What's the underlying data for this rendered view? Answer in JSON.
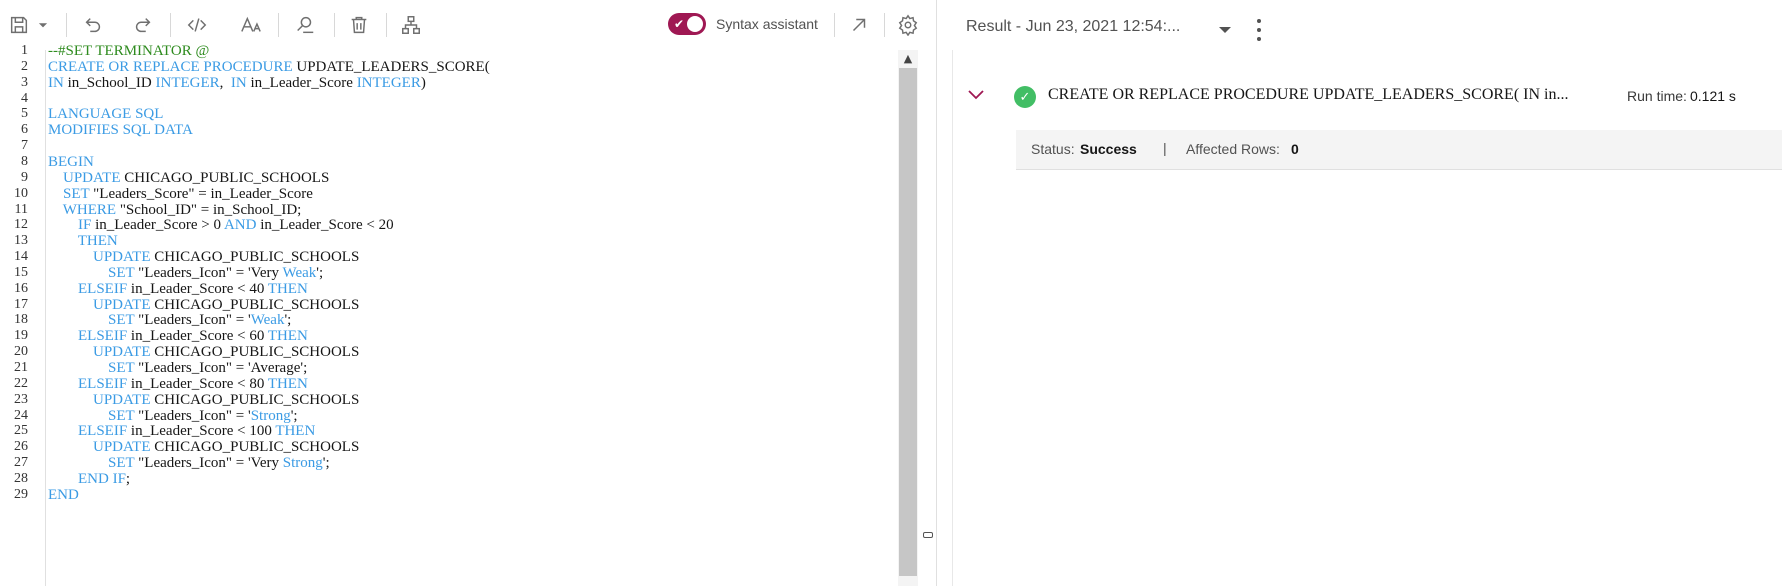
{
  "toolbar": {
    "icons": [
      "save-icon",
      "save-dropdown-icon",
      "undo-icon",
      "redo-icon",
      "code-format-icon",
      "font-size-icon",
      "find-replace-icon",
      "delete-icon",
      "explain-plan-icon",
      "expand-icon",
      "settings-icon"
    ],
    "syntax_assistant_label": "Syntax assistant",
    "syntax_assistant_on": true,
    "accent": "#9f1853"
  },
  "editor": {
    "line_numbers": [
      "1",
      "2",
      "3",
      "4",
      "5",
      "6",
      "7",
      "8",
      "9",
      "10",
      "11",
      "12",
      "13",
      "14",
      "15",
      "16",
      "17",
      "18",
      "19",
      "20",
      "21",
      "22",
      "23",
      "24",
      "25",
      "26",
      "27",
      "28",
      "29"
    ],
    "colors": {
      "keyword": "#3b9be4",
      "comment": "#2e8b1e",
      "text": "#161616"
    },
    "lines": [
      [
        {
          "t": "--#SET TERMINATOR @",
          "c": "cm"
        }
      ],
      [
        {
          "t": "CREATE OR REPLACE PROCEDURE",
          "c": "kw"
        },
        {
          "t": " UPDATE_LEADERS_SCORE(",
          "c": ""
        }
      ],
      [
        {
          "t": "IN",
          "c": "kw"
        },
        {
          "t": " in_School_ID ",
          "c": ""
        },
        {
          "t": "INTEGER",
          "c": "kw"
        },
        {
          "t": ",  ",
          "c": ""
        },
        {
          "t": "IN",
          "c": "kw"
        },
        {
          "t": " in_Leader_Score ",
          "c": ""
        },
        {
          "t": "INTEGER",
          "c": "kw"
        },
        {
          "t": ")",
          "c": ""
        }
      ],
      [],
      [
        {
          "t": "LANGUAGE SQL",
          "c": "kw"
        }
      ],
      [
        {
          "t": "MODIFIES SQL DATA",
          "c": "kw"
        }
      ],
      [],
      [
        {
          "t": "BEGIN",
          "c": "kw"
        }
      ],
      [
        {
          "t": "    ",
          "c": ""
        },
        {
          "t": "UPDATE",
          "c": "kw"
        },
        {
          "t": " CHICAGO_PUBLIC_SCHOOLS",
          "c": ""
        }
      ],
      [
        {
          "t": "    ",
          "c": ""
        },
        {
          "t": "SET",
          "c": "kw"
        },
        {
          "t": " \"Leaders_Score\" = in_Leader_Score",
          "c": ""
        }
      ],
      [
        {
          "t": "    ",
          "c": ""
        },
        {
          "t": "WHERE",
          "c": "kw"
        },
        {
          "t": " \"School_ID\" = in_School_ID;",
          "c": ""
        }
      ],
      [
        {
          "t": "        ",
          "c": ""
        },
        {
          "t": "IF",
          "c": "kw"
        },
        {
          "t": " in_Leader_Score > 0 ",
          "c": ""
        },
        {
          "t": "AND",
          "c": "kw"
        },
        {
          "t": " in_Leader_Score < 20",
          "c": ""
        }
      ],
      [
        {
          "t": "        ",
          "c": ""
        },
        {
          "t": "THEN",
          "c": "kw"
        }
      ],
      [
        {
          "t": "            ",
          "c": ""
        },
        {
          "t": "UPDATE",
          "c": "kw"
        },
        {
          "t": " CHICAGO_PUBLIC_SCHOOLS",
          "c": ""
        }
      ],
      [
        {
          "t": "                ",
          "c": ""
        },
        {
          "t": "SET",
          "c": "kw"
        },
        {
          "t": " \"Leaders_Icon\" = 'Very ",
          "c": ""
        },
        {
          "t": "Weak",
          "c": "kw"
        },
        {
          "t": "';",
          "c": ""
        }
      ],
      [
        {
          "t": "        ",
          "c": ""
        },
        {
          "t": "ELSEIF",
          "c": "kw"
        },
        {
          "t": " in_Leader_Score < 40 ",
          "c": ""
        },
        {
          "t": "THEN",
          "c": "kw"
        }
      ],
      [
        {
          "t": "            ",
          "c": ""
        },
        {
          "t": "UPDATE",
          "c": "kw"
        },
        {
          "t": " CHICAGO_PUBLIC_SCHOOLS",
          "c": ""
        }
      ],
      [
        {
          "t": "                ",
          "c": ""
        },
        {
          "t": "SET",
          "c": "kw"
        },
        {
          "t": " \"Leaders_Icon\" = '",
          "c": ""
        },
        {
          "t": "Weak",
          "c": "kw"
        },
        {
          "t": "';",
          "c": ""
        }
      ],
      [
        {
          "t": "        ",
          "c": ""
        },
        {
          "t": "ELSEIF",
          "c": "kw"
        },
        {
          "t": " in_Leader_Score < 60 ",
          "c": ""
        },
        {
          "t": "THEN",
          "c": "kw"
        }
      ],
      [
        {
          "t": "            ",
          "c": ""
        },
        {
          "t": "UPDATE",
          "c": "kw"
        },
        {
          "t": " CHICAGO_PUBLIC_SCHOOLS",
          "c": ""
        }
      ],
      [
        {
          "t": "                ",
          "c": ""
        },
        {
          "t": "SET",
          "c": "kw"
        },
        {
          "t": " \"Leaders_Icon\" = 'Average';",
          "c": ""
        }
      ],
      [
        {
          "t": "        ",
          "c": ""
        },
        {
          "t": "ELSEIF",
          "c": "kw"
        },
        {
          "t": " in_Leader_Score < 80 ",
          "c": ""
        },
        {
          "t": "THEN",
          "c": "kw"
        }
      ],
      [
        {
          "t": "            ",
          "c": ""
        },
        {
          "t": "UPDATE",
          "c": "kw"
        },
        {
          "t": " CHICAGO_PUBLIC_SCHOOLS",
          "c": ""
        }
      ],
      [
        {
          "t": "                ",
          "c": ""
        },
        {
          "t": "SET",
          "c": "kw"
        },
        {
          "t": " \"Leaders_Icon\" = '",
          "c": ""
        },
        {
          "t": "Strong",
          "c": "kw"
        },
        {
          "t": "';",
          "c": ""
        }
      ],
      [
        {
          "t": "        ",
          "c": ""
        },
        {
          "t": "ELSEIF",
          "c": "kw"
        },
        {
          "t": " in_Leader_Score < 100 ",
          "c": ""
        },
        {
          "t": "THEN",
          "c": "kw"
        }
      ],
      [
        {
          "t": "            ",
          "c": ""
        },
        {
          "t": "UPDATE",
          "c": "kw"
        },
        {
          "t": " CHICAGO_PUBLIC_SCHOOLS",
          "c": ""
        }
      ],
      [
        {
          "t": "                ",
          "c": ""
        },
        {
          "t": "SET",
          "c": "kw"
        },
        {
          "t": " \"Leaders_Icon\" = 'Very ",
          "c": ""
        },
        {
          "t": "Strong",
          "c": "kw"
        },
        {
          "t": "';",
          "c": ""
        }
      ],
      [
        {
          "t": "        ",
          "c": ""
        },
        {
          "t": "END IF",
          "c": "kw"
        },
        {
          "t": ";",
          "c": ""
        }
      ],
      [
        {
          "t": "END",
          "c": "kw"
        }
      ]
    ]
  },
  "result": {
    "title": "Result - Jun 23, 2021 12:54:...",
    "statement": "CREATE OR REPLACE PROCEDURE UPDATE_LEADERS_SCORE( IN in...",
    "run_time_label": "Run time:",
    "run_time_value": "0.121 s",
    "status_label": "Status:",
    "status_value": "Success",
    "separator": "|",
    "affected_rows_label": "Affected Rows:",
    "affected_rows_value": "0",
    "success_color": "#42be65",
    "chevron_color": "#9f1853"
  }
}
